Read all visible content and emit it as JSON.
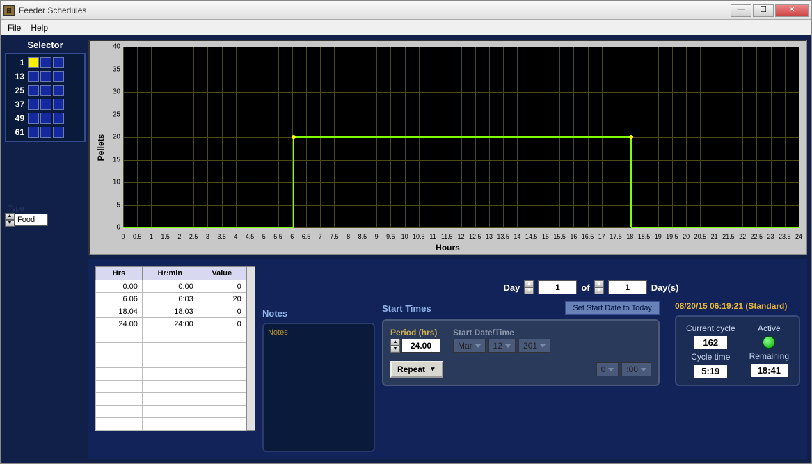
{
  "window": {
    "title": "Feeder Schedules"
  },
  "menu": {
    "file": "File",
    "help": "Help"
  },
  "sidebar": {
    "title": "Selector",
    "rows": [
      {
        "label": "1"
      },
      {
        "label": "13"
      },
      {
        "label": "25"
      },
      {
        "label": "37"
      },
      {
        "label": "49"
      },
      {
        "label": "61"
      }
    ],
    "type_label": "Type",
    "type_value": "Food"
  },
  "chart_data": {
    "type": "line-step",
    "title": "",
    "xlabel": "Hours",
    "ylabel": "Pellets",
    "xlim": [
      0,
      24
    ],
    "ylim": [
      0,
      40
    ],
    "xticks": [
      0,
      0.5,
      1,
      1.5,
      2,
      2.5,
      3,
      3.5,
      4,
      4.5,
      5,
      5.5,
      6,
      6.5,
      7,
      7.5,
      8,
      8.5,
      9,
      9.5,
      10,
      10.5,
      11,
      11.5,
      12,
      12.5,
      13,
      13.5,
      14,
      14.5,
      15,
      15.5,
      16,
      16.5,
      17,
      17.5,
      18,
      18.5,
      19,
      19.5,
      20,
      20.5,
      21,
      21.5,
      22,
      22.5,
      23,
      23.5,
      24
    ],
    "yticks": [
      0,
      5,
      10,
      15,
      20,
      25,
      30,
      35,
      40
    ],
    "series": [
      {
        "name": "Pellets",
        "points": [
          {
            "x": 0,
            "y": 0
          },
          {
            "x": 6.06,
            "y": 0
          },
          {
            "x": 6.06,
            "y": 20
          },
          {
            "x": 18.04,
            "y": 20
          },
          {
            "x": 18.04,
            "y": 0
          },
          {
            "x": 24,
            "y": 0
          }
        ]
      }
    ]
  },
  "table": {
    "headers": {
      "hrs": "Hrs",
      "hrmin": "Hr:min",
      "value": "Value"
    },
    "rows": [
      {
        "hrs": "0.00",
        "hrmin": "0:00",
        "value": "0"
      },
      {
        "hrs": "6.06",
        "hrmin": "6:03",
        "value": "20"
      },
      {
        "hrs": "18.04",
        "hrmin": "18:03",
        "value": "0"
      },
      {
        "hrs": "24.00",
        "hrmin": "24:00",
        "value": "0"
      }
    ]
  },
  "notes": {
    "title": "Notes",
    "content": "Notes"
  },
  "day": {
    "label": "Day",
    "value": "1",
    "of": "of",
    "total": "1",
    "suffix": "Day(s)"
  },
  "start": {
    "title": "Start Times",
    "set_btn": "Set Start Date to Today",
    "period_label": "Period (hrs)",
    "period_value": "24.00",
    "start_label": "Start  Date/Time",
    "month": "Mar",
    "day_v": "12",
    "year": "201",
    "hour": "0",
    "min": ":00",
    "repeat": "Repeat"
  },
  "status": {
    "timestamp": "08/20/15 06:19:21 (Standard)",
    "current_cycle_label": "Current cycle",
    "current_cycle": "162",
    "active_label": "Active",
    "cycle_time_label": "Cycle time",
    "cycle_time": "5:19",
    "remaining_label": "Remaining",
    "remaining": "18:41"
  }
}
